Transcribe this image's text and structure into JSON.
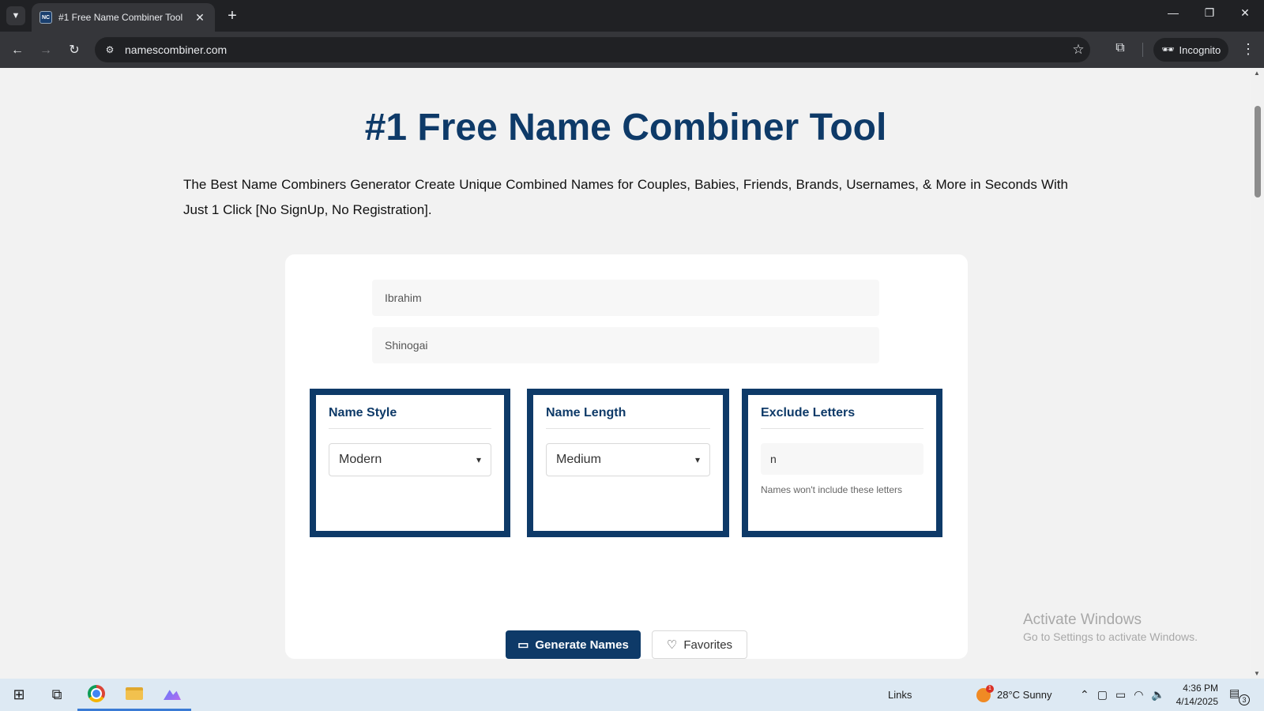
{
  "browser": {
    "tab_title": "#1 Free Name Combiner Tool",
    "favicon_text": "NC",
    "url": "namescombiner.com",
    "incognito_label": "Incognito"
  },
  "page": {
    "title": "#1 Free Name Combiner Tool",
    "intro": "The Best Name Combiners Generator Create Unique Combined Names for Couples, Babies, Friends, Brands, Usernames, & More in Seconds With Just 1 Click [No SignUp, No Registration].",
    "name1_value": "Ibrahim",
    "name2_value": "Shinogai",
    "options": {
      "style": {
        "title": "Name Style",
        "selected": "Modern"
      },
      "length": {
        "title": "Name Length",
        "selected": "Medium"
      },
      "exclude": {
        "title": "Exclude Letters",
        "value": "n",
        "hint": "Names won't include these letters"
      }
    },
    "generate_label": "Generate Names",
    "favorites_label": "Favorites"
  },
  "watermark": {
    "line1": "Activate Windows",
    "line2": "Go to Settings to activate Windows."
  },
  "taskbar": {
    "links_label": "Links",
    "weather_badge": "1",
    "weather": "28°C  Sunny",
    "time": "4:36 PM",
    "date": "4/14/2025",
    "notification_count": "3"
  },
  "colors": {
    "brand_navy": "#0e3a68",
    "page_bg": "#f2f2f2"
  }
}
